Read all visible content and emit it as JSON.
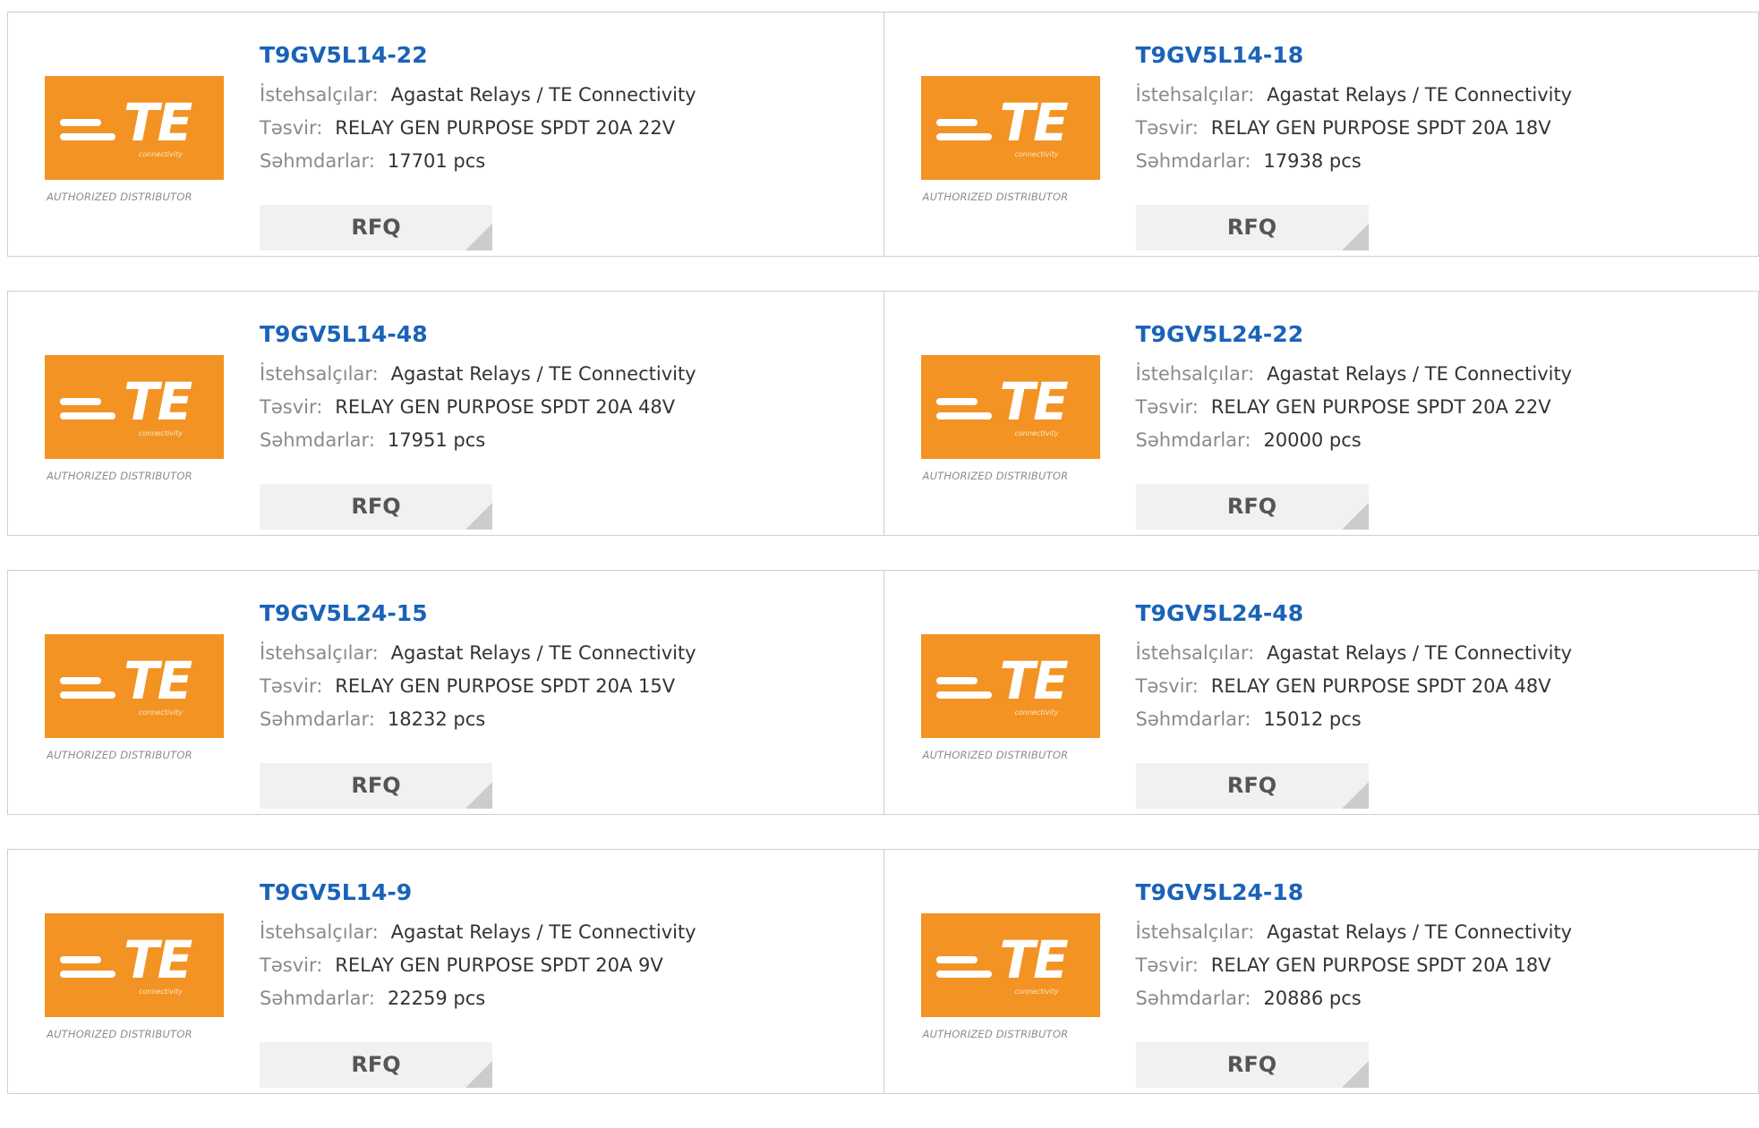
{
  "labels": {
    "manufacturer": "İstehsalçılar:",
    "description": "Təsvir:",
    "stock": "Səhmdarlar:"
  },
  "logo": {
    "text": "TE",
    "subtext": "connectivity",
    "caption": "AUTHORIZED DISTRIBUTOR",
    "color": "#f39324"
  },
  "rfq_label": "RFQ",
  "products": [
    {
      "part": "T9GV5L14-22",
      "manufacturer": "Agastat Relays / TE Connectivity",
      "description": "RELAY GEN PURPOSE SPDT 20A 22V",
      "stock": "17701 pcs"
    },
    {
      "part": "T9GV5L14-18",
      "manufacturer": "Agastat Relays / TE Connectivity",
      "description": "RELAY GEN PURPOSE SPDT 20A 18V",
      "stock": "17938 pcs"
    },
    {
      "part": "T9GV5L14-48",
      "manufacturer": "Agastat Relays / TE Connectivity",
      "description": "RELAY GEN PURPOSE SPDT 20A 48V",
      "stock": "17951 pcs"
    },
    {
      "part": "T9GV5L24-22",
      "manufacturer": "Agastat Relays / TE Connectivity",
      "description": "RELAY GEN PURPOSE SPDT 20A 22V",
      "stock": "20000 pcs"
    },
    {
      "part": "T9GV5L24-15",
      "manufacturer": "Agastat Relays / TE Connectivity",
      "description": "RELAY GEN PURPOSE SPDT 20A 15V",
      "stock": "18232 pcs"
    },
    {
      "part": "T9GV5L24-48",
      "manufacturer": "Agastat Relays / TE Connectivity",
      "description": "RELAY GEN PURPOSE SPDT 20A 48V",
      "stock": "15012 pcs"
    },
    {
      "part": "T9GV5L14-9",
      "manufacturer": "Agastat Relays / TE Connectivity",
      "description": "RELAY GEN PURPOSE SPDT 20A 9V",
      "stock": "22259 pcs"
    },
    {
      "part": "T9GV5L24-18",
      "manufacturer": "Agastat Relays / TE Connectivity",
      "description": "RELAY GEN PURPOSE SPDT 20A 18V",
      "stock": "20886 pcs"
    }
  ]
}
